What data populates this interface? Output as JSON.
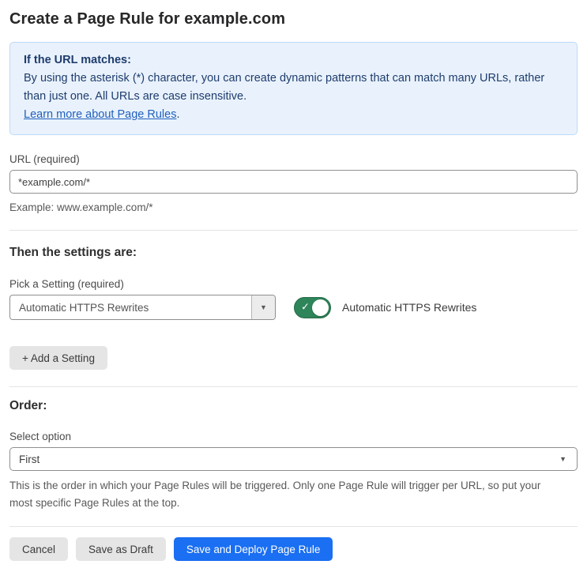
{
  "page": {
    "title": "Create a Page Rule for example.com"
  },
  "info_box": {
    "heading": "If the URL matches:",
    "body": "By using the asterisk (*) character, you can create dynamic patterns that can match many URLs, rather than just one. All URLs are case insensitive.",
    "link": "Learn more about Page Rules",
    "link_suffix": "."
  },
  "url_field": {
    "label": "URL (required)",
    "value": "*example.com/*",
    "helper": "Example: www.example.com/*"
  },
  "settings_section": {
    "heading": "Then the settings are:",
    "picker_label": "Pick a Setting (required)",
    "picker_value": "Automatic HTTPS Rewrites",
    "toggle_state": "on",
    "toggle_label": "Automatic HTTPS Rewrites",
    "add_setting_button": "+ Add a Setting"
  },
  "order_section": {
    "heading": "Order:",
    "select_label": "Select option",
    "select_value": "First",
    "helper": "This is the order in which your Page Rules will be triggered. Only one Page Rule will trigger per URL, so put your most specific Page Rules at the top."
  },
  "footer": {
    "cancel_label": "Cancel",
    "save_draft_label": "Save as Draft",
    "save_deploy_label": "Save and Deploy Page Rule"
  },
  "icons": {
    "dropdown_arrow": "▼",
    "toggle_check": "✓"
  },
  "colors": {
    "accent_blue": "#1a6ff2",
    "toggle_green": "#2f855a",
    "info_bg": "#e9f2fc",
    "info_border": "#bcd9f7",
    "info_text": "#1e3c6e",
    "link_blue": "#2160bd"
  }
}
